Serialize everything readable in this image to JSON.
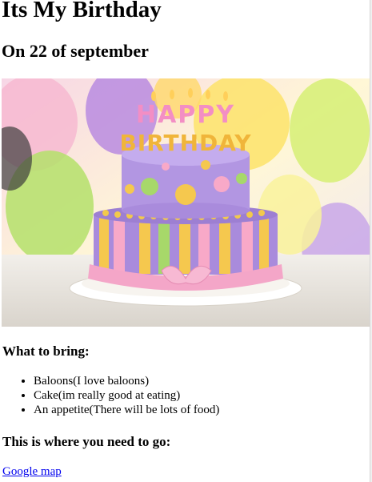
{
  "page": {
    "title": "Its My Birthday",
    "date_heading": "On 22 of september",
    "cake_banner": "HAPPY BIRTHDAY"
  },
  "bring": {
    "heading": "What to bring:",
    "items": [
      "Baloons(I love baloons)",
      "Cake(im really good at eating)",
      "An appetite(There will be lots of food)"
    ]
  },
  "directions": {
    "heading": "This is where you need to go:",
    "link_label": "Google map"
  },
  "colors": {
    "link": "#0000ee",
    "cake_purple": "#9b7fd6",
    "ribbon_pink": "#f4a6c8"
  }
}
